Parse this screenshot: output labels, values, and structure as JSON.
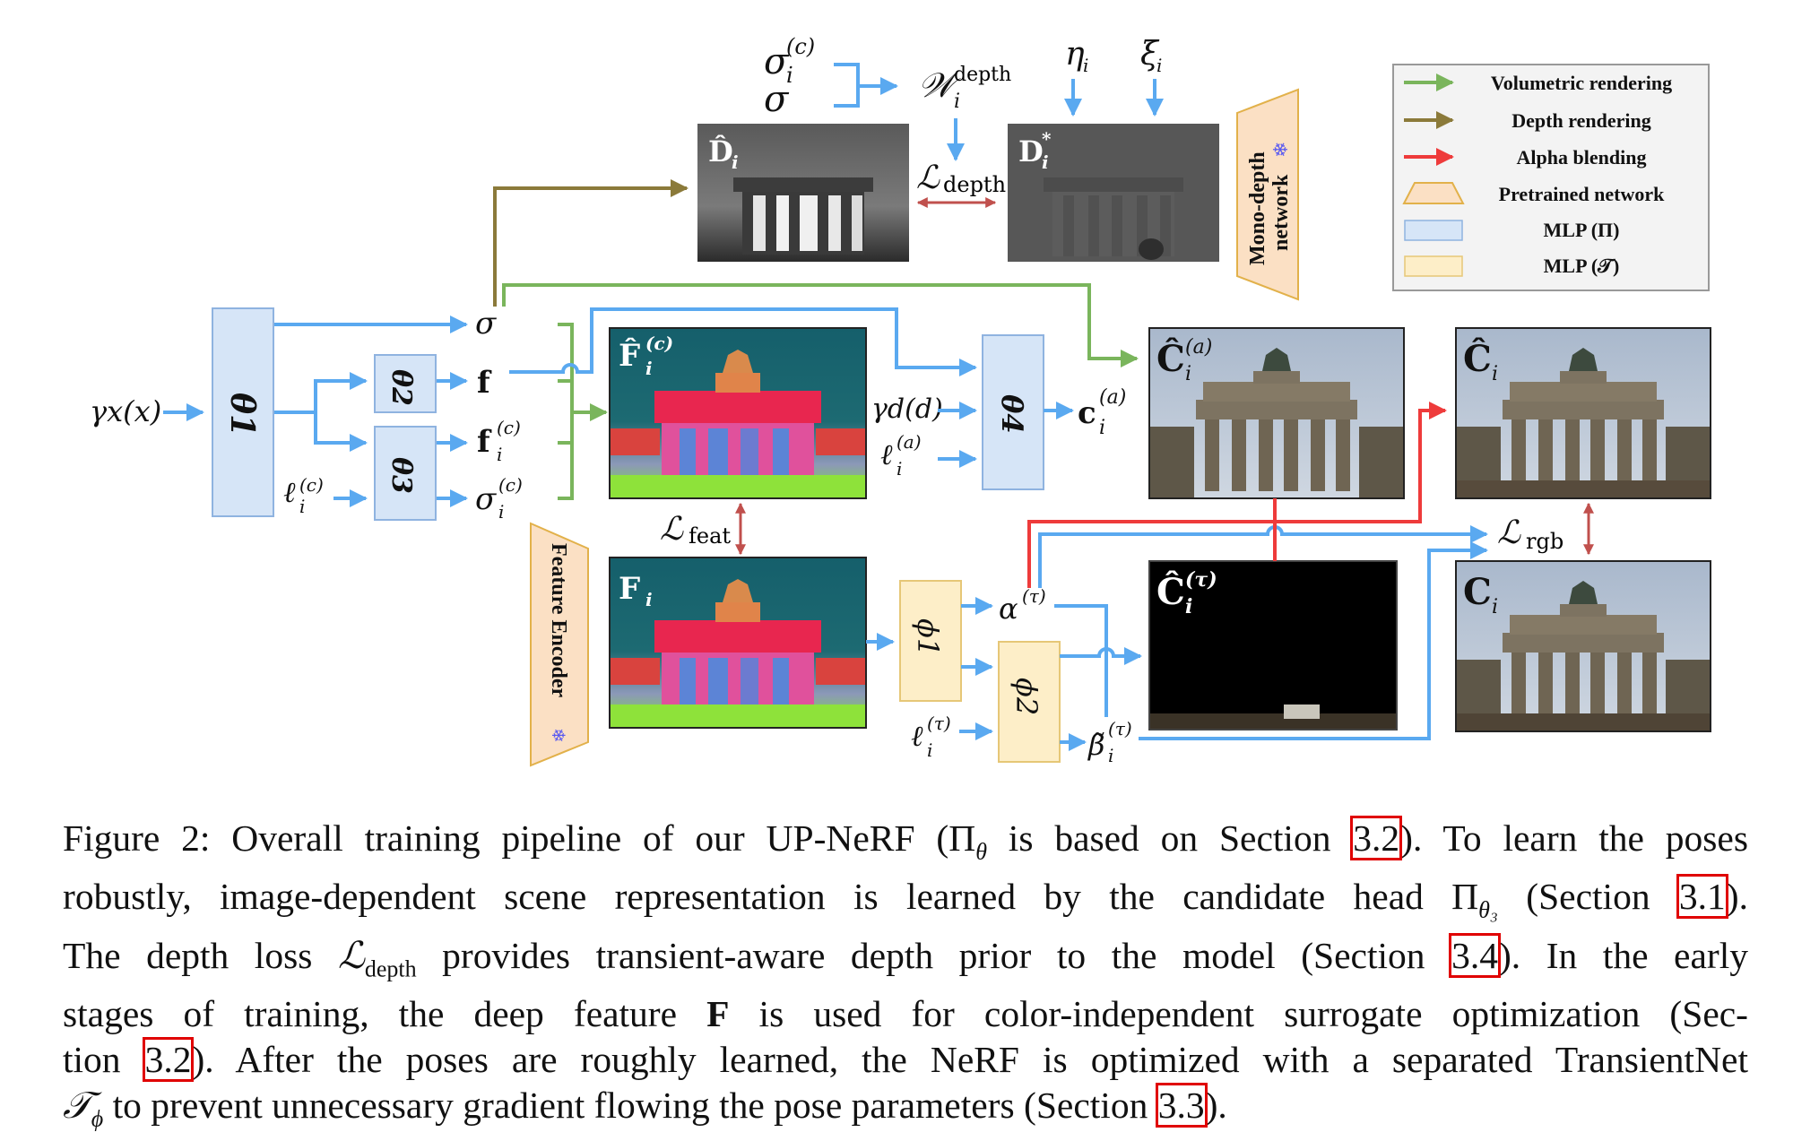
{
  "legend": {
    "items": [
      {
        "kind": "arrow",
        "color": "#7ab55c",
        "label": "Volumetric rendering"
      },
      {
        "kind": "arrow",
        "color": "#8b7a3a",
        "label": "Depth rendering"
      },
      {
        "kind": "arrow",
        "color": "#ee3b3b",
        "label": "Alpha blending"
      },
      {
        "kind": "trapezoid",
        "color": "#fbe0c4",
        "label": "Pretrained network"
      },
      {
        "kind": "box",
        "color": "#d6e5f7",
        "label": "MLP (Π)"
      },
      {
        "kind": "box",
        "color": "#fdeec8",
        "label": "MLP (𝒯)"
      }
    ]
  },
  "colors": {
    "blue_arrow": "#5aa9f0",
    "green_arrow": "#7ab55c",
    "olive_arrow": "#8b7a3a",
    "red_arrow": "#ee3b3b",
    "loss_arrow": "#c0504d",
    "mlp_pi_fill": "#d6e5f7",
    "mlp_pi_stroke": "#8fb3e0",
    "mlp_t_fill": "#fdeec8",
    "mlp_t_stroke": "#e6c777",
    "pretrained_fill": "#fbe0c4",
    "pretrained_stroke": "#e2b14a",
    "snowflake": "#5b5bf0"
  },
  "nodes": {
    "input_x": "γx(x)",
    "theta1": "θ1",
    "theta2": "θ2",
    "theta3": "θ3",
    "theta4": "θ4",
    "phi1": "ϕ1",
    "phi2": "ϕ2",
    "sigma": "σ",
    "f": "f",
    "f_c": "f",
    "f_c_sup": "(c)",
    "f_c_sub": "i",
    "sigma_c": "σ",
    "sigma_c_sup": "(c)",
    "sigma_c_sub": "i",
    "l_c": "ℓ",
    "l_c_sup": "(c)",
    "l_c_sub": "i",
    "gamma_d": "γd(d)",
    "l_a": "ℓ",
    "l_a_sup": "(a)",
    "l_a_sub": "i",
    "c_a": "c",
    "c_a_sup": "(a)",
    "c_a_sub": "i",
    "alpha_t": "α",
    "alpha_t_sup": "(τ)",
    "l_t": "ℓ",
    "l_t_sup": "(τ)",
    "l_t_sub": "i",
    "beta_t": "β̃",
    "beta_t_sup": "(τ)",
    "beta_t_sub": "i",
    "top_sigma_c": "σ",
    "top_sigma_c_sup": "(c)",
    "top_sigma_c_sub": "i",
    "top_sigma": "σ",
    "w_depth": "𝒲",
    "w_depth_sup": "depth",
    "w_depth_sub": "i",
    "eta": "η",
    "eta_sub": "i",
    "xi": "ξ",
    "xi_sub": "i",
    "feature_encoder": "Feature Encoder",
    "mono_depth_1": "Mono-depth",
    "mono_depth_2": "network",
    "snowflake_icon": "❄"
  },
  "losses": {
    "depth": "ℒ",
    "depth_sub": "depth",
    "feat": "ℒ",
    "feat_sub": "feat",
    "rgb": "ℒ",
    "rgb_sub": "rgb"
  },
  "images": {
    "d_hat": {
      "label": "D̂",
      "sub": "i"
    },
    "d_star": {
      "label": "D",
      "sup": "*",
      "sub": "i"
    },
    "f_hat_c": {
      "label": "F̂",
      "sup": "(c)",
      "sub": "i"
    },
    "f_i": {
      "label": "F",
      "sub": "i"
    },
    "c_hat_a": {
      "label": "Ĉ",
      "sup": "(a)",
      "sub": "i"
    },
    "c_hat": {
      "label": "Ĉ",
      "sub": "i"
    },
    "c_hat_t": {
      "label": "Ĉ",
      "sup": "(τ)",
      "sub": "i"
    },
    "c_gt": {
      "label": "C",
      "sub": "i"
    }
  },
  "caption": {
    "lines": [
      [
        {
          "t": "Figure 2: Overall training pipeline of our UP-NeRF (Π"
        },
        {
          "t": "θ",
          "sub": true,
          "it": true
        },
        {
          "t": " is based on Section "
        },
        {
          "t": "3.2",
          "ref": true
        },
        {
          "t": "). To learn the poses"
        }
      ],
      [
        {
          "t": "robustly, image-dependent scene representation is learned by the candidate head Π"
        },
        {
          "t": "θ₃",
          "sub": true,
          "it": true
        },
        {
          "t": " (Section "
        },
        {
          "t": "3.1",
          "ref": true
        },
        {
          "t": ")."
        }
      ],
      [
        {
          "t": "The depth loss "
        },
        {
          "t": "ℒ",
          "it": true
        },
        {
          "t": "depth",
          "sub": true
        },
        {
          "t": " provides transient-aware depth prior to the model (Section "
        },
        {
          "t": "3.4",
          "ref": true
        },
        {
          "t": "). In the early"
        }
      ],
      [
        {
          "t": "stages of training, the deep feature "
        },
        {
          "t": "F",
          "bf": true
        },
        {
          "t": " is used for color-independent surrogate optimization (Sec-"
        }
      ],
      [
        {
          "t": "tion "
        },
        {
          "t": "3.2",
          "ref": true
        },
        {
          "t": "). After the poses are roughly learned, the NeRF is optimized with a separated TransientNet"
        }
      ],
      [
        {
          "t": "𝒯",
          "it": true
        },
        {
          "t": "ϕ",
          "sub": true,
          "it": true
        },
        {
          "t": " to prevent unnecessary gradient flowing the pose parameters (Section "
        },
        {
          "t": "3.3",
          "ref": true
        },
        {
          "t": ")."
        }
      ]
    ]
  }
}
